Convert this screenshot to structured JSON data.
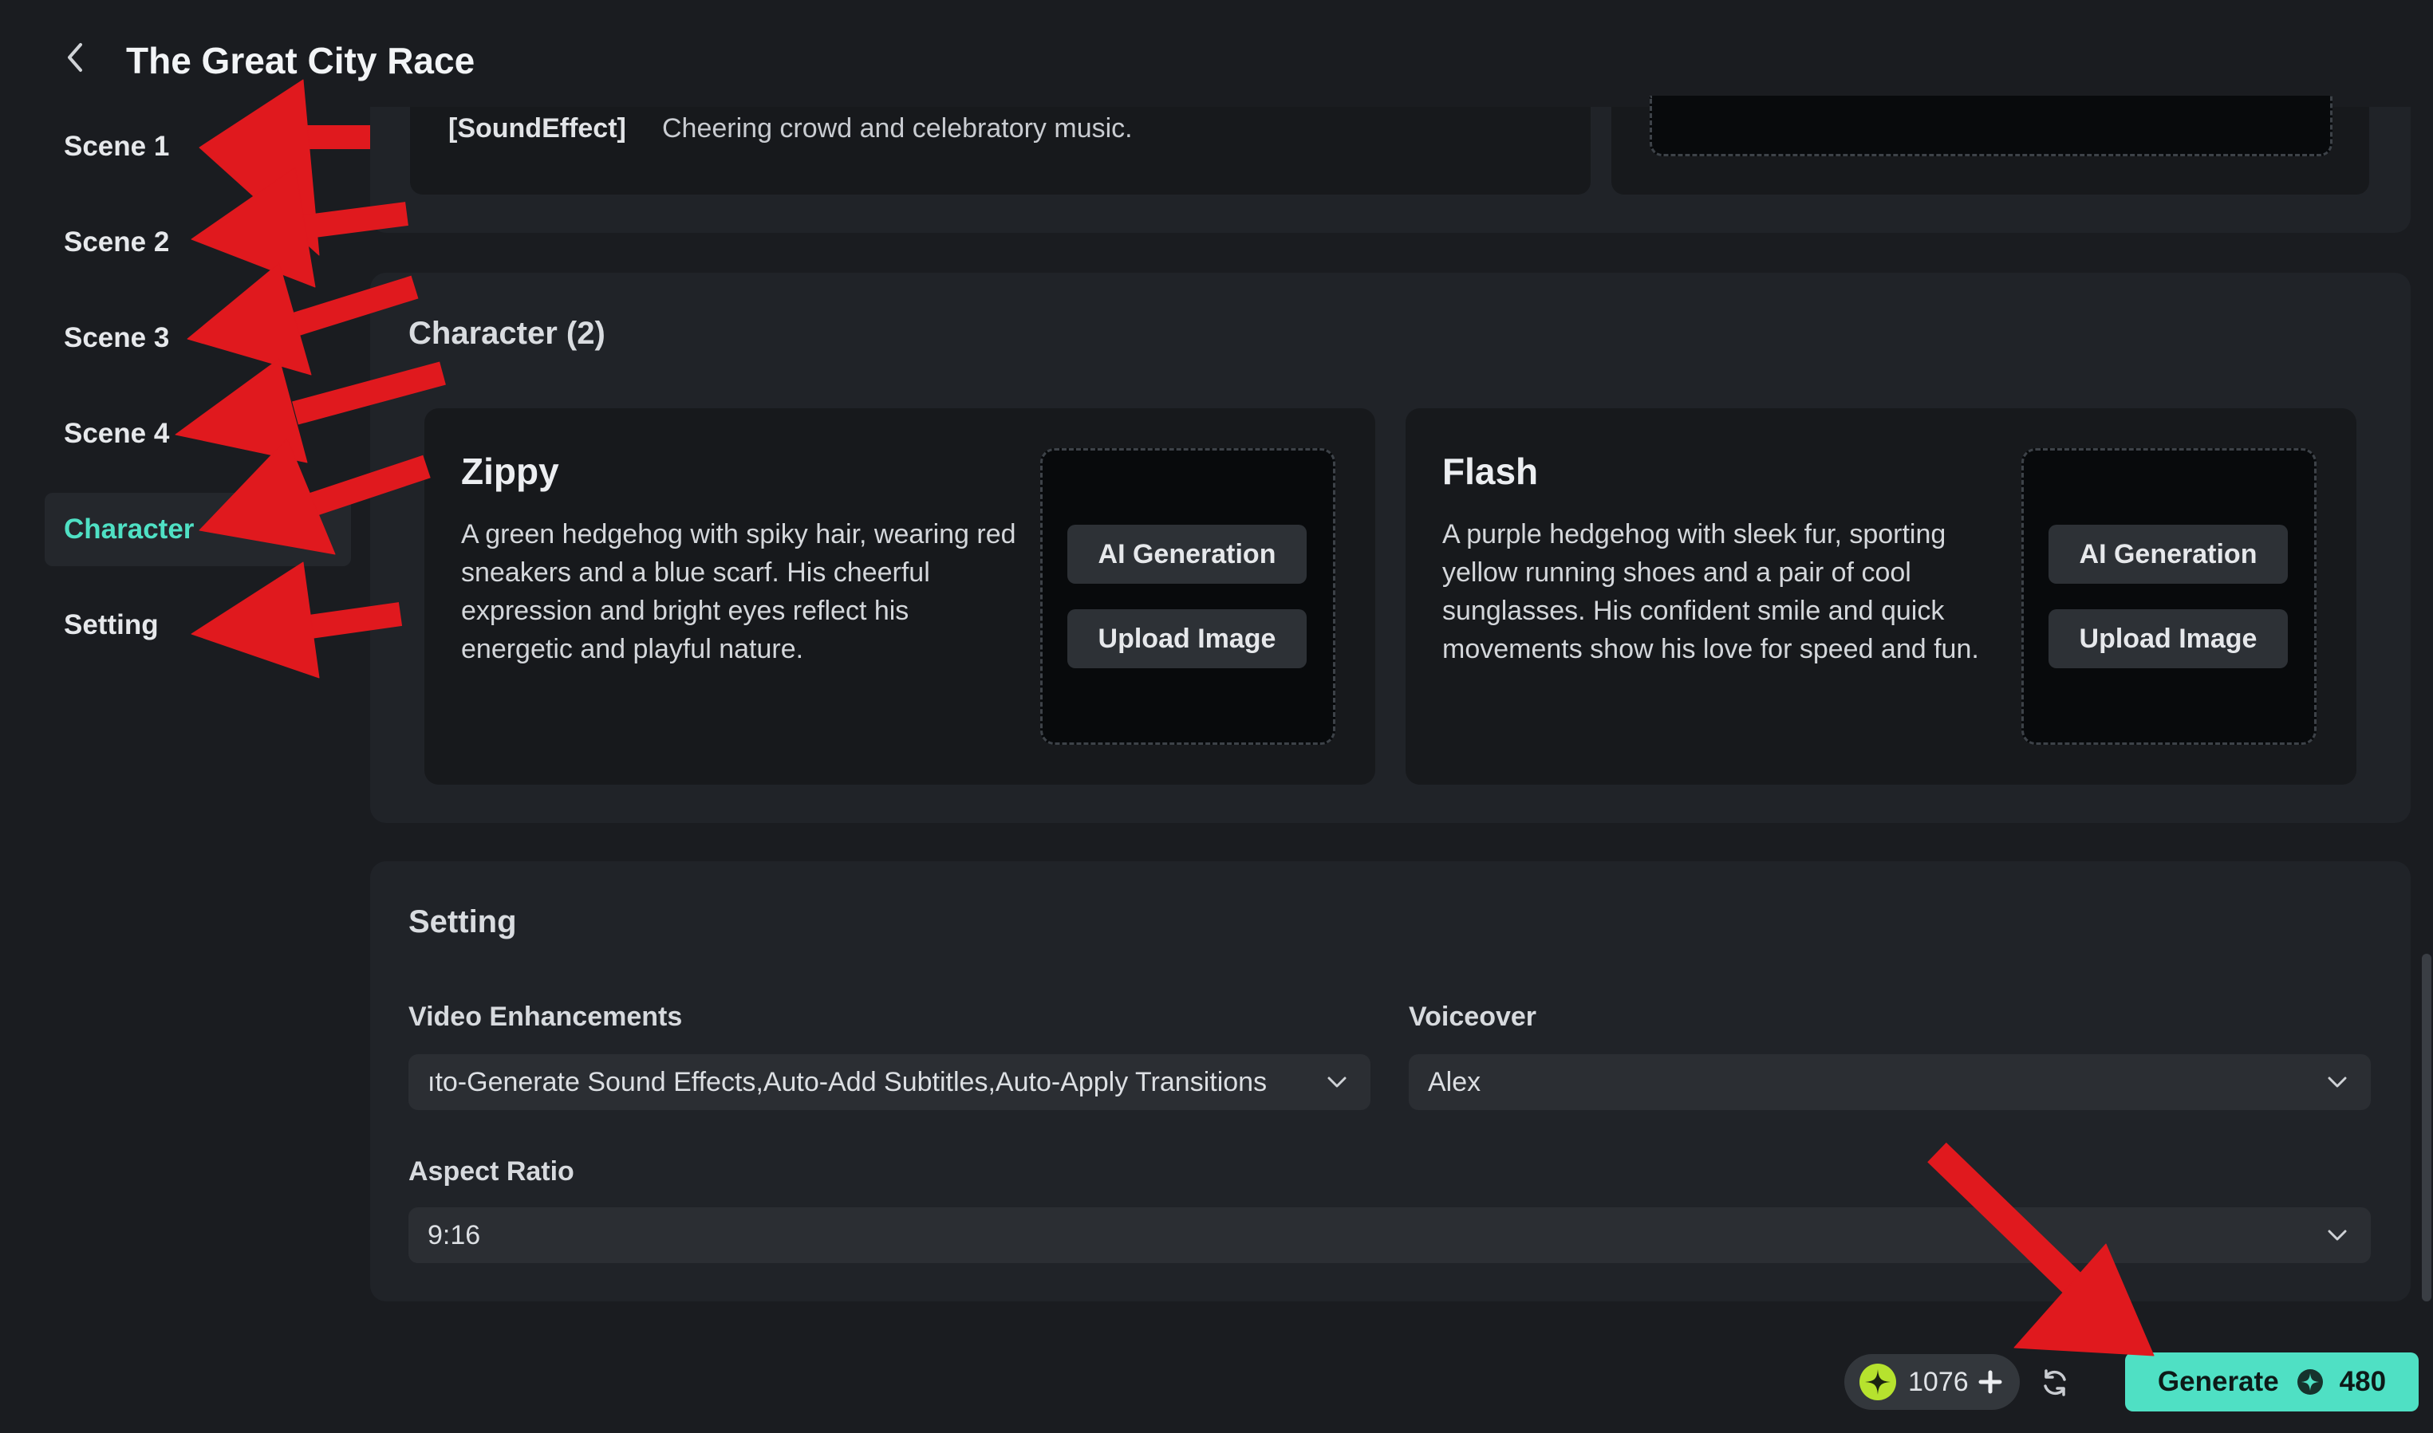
{
  "header": {
    "title": "The Great City Race"
  },
  "sidebar": {
    "items": [
      {
        "label": "Scene 1"
      },
      {
        "label": "Scene 2"
      },
      {
        "label": "Scene 3"
      },
      {
        "label": "Scene 4"
      },
      {
        "label": "Character",
        "active": true
      },
      {
        "label": "Setting"
      }
    ]
  },
  "scene": {
    "sound_tag": "[SoundEffect]",
    "sound_text": "Cheering crowd and celebratory music."
  },
  "character": {
    "title": "Character (2)",
    "cards": [
      {
        "name": "Zippy",
        "description": "A green hedgehog with spiky hair, wearing red sneakers and a blue scarf. His cheerful expression and bright eyes reflect his energetic and playful nature.",
        "ai_button": "AI Generation",
        "upload_button": "Upload Image"
      },
      {
        "name": "Flash",
        "description": "A purple hedgehog with sleek fur, sporting yellow running shoes and a pair of cool sunglasses. His confident smile and quick movements show his love for speed and fun.",
        "ai_button": "AI Generation",
        "upload_button": "Upload Image"
      }
    ]
  },
  "setting": {
    "title": "Setting",
    "video_enhancements": {
      "label": "Video Enhancements",
      "value": "ıto-Generate Sound Effects,Auto-Add Subtitles,Auto-Apply Transitions"
    },
    "voiceover": {
      "label": "Voiceover",
      "value": "Alex"
    },
    "aspect_ratio": {
      "label": "Aspect Ratio",
      "value": "9:16"
    }
  },
  "footer": {
    "credits": "1076",
    "generate_label": "Generate",
    "generate_cost": "480"
  },
  "colors": {
    "accent": "#4fe0c4",
    "annotation": "#e0191e"
  },
  "icons": [
    "back-icon",
    "credit-star-icon",
    "plus-icon",
    "refresh-icon",
    "chevron-down-icon",
    "coin-icon"
  ]
}
